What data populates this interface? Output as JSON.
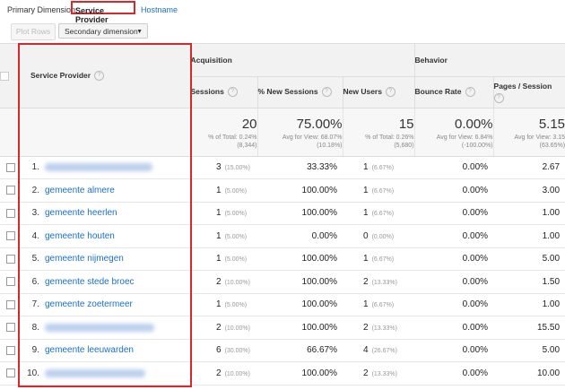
{
  "primary_dimension": {
    "label": "Primary Dimension:",
    "active": "Service Provider",
    "other": "Hostname"
  },
  "toolbar": {
    "plot_rows": "Plot Rows",
    "secondary_dimension": "Secondary dimension"
  },
  "groups": {
    "acquisition": "Acquisition",
    "behavior": "Behavior"
  },
  "columns": {
    "service_provider": "Service Provider",
    "sessions": "Sessions",
    "new_sessions": "% New Sessions",
    "new_users": "New Users",
    "bounce_rate": "Bounce Rate",
    "pages_session": "Pages / Session"
  },
  "totals": {
    "sessions": "20",
    "sessions_note1": "% of Total: 0.24%",
    "sessions_note2": "(8,344)",
    "new_sessions": "75.00%",
    "new_sessions_note1": "Avg for View: 68.07%",
    "new_sessions_note2": "(10.18%)",
    "new_users": "15",
    "new_users_note1": "% of Total: 0.26%",
    "new_users_note2": "(5,680)",
    "bounce_rate": "0.00%",
    "bounce_rate_note1": "Avg for View: 6.84%",
    "bounce_rate_note2": "(-100.00%)",
    "pages_session": "5.15",
    "pages_session_note1": "Avg for View: 3.15",
    "pages_session_note2": "(63.65%)"
  },
  "rows": [
    {
      "index": "1.",
      "provider": "",
      "sessions": "3",
      "sessions_pct": "(15.00%)",
      "new_sessions": "33.33%",
      "new_users": "1",
      "new_users_pct": "(6.67%)",
      "bounce": "0.00%",
      "pages": "2.67"
    },
    {
      "index": "2.",
      "provider": "gemeente almere",
      "sessions": "1",
      "sessions_pct": "(5.00%)",
      "new_sessions": "100.00%",
      "new_users": "1",
      "new_users_pct": "(6.67%)",
      "bounce": "0.00%",
      "pages": "3.00"
    },
    {
      "index": "3.",
      "provider": "gemeente heerlen",
      "sessions": "1",
      "sessions_pct": "(5.00%)",
      "new_sessions": "100.00%",
      "new_users": "1",
      "new_users_pct": "(6.67%)",
      "bounce": "0.00%",
      "pages": "1.00"
    },
    {
      "index": "4.",
      "provider": "gemeente houten",
      "sessions": "1",
      "sessions_pct": "(5.00%)",
      "new_sessions": "0.00%",
      "new_users": "0",
      "new_users_pct": "(0.00%)",
      "bounce": "0.00%",
      "pages": "1.00"
    },
    {
      "index": "5.",
      "provider": "gemeente nijmegen",
      "sessions": "1",
      "sessions_pct": "(5.00%)",
      "new_sessions": "100.00%",
      "new_users": "1",
      "new_users_pct": "(6.67%)",
      "bounce": "0.00%",
      "pages": "5.00"
    },
    {
      "index": "6.",
      "provider": "gemeente stede broec",
      "sessions": "2",
      "sessions_pct": "(10.00%)",
      "new_sessions": "100.00%",
      "new_users": "2",
      "new_users_pct": "(13.33%)",
      "bounce": "0.00%",
      "pages": "1.50"
    },
    {
      "index": "7.",
      "provider": "gemeente zoetermeer",
      "sessions": "1",
      "sessions_pct": "(5.00%)",
      "new_sessions": "100.00%",
      "new_users": "1",
      "new_users_pct": "(6.67%)",
      "bounce": "0.00%",
      "pages": "1.00"
    },
    {
      "index": "8.",
      "provider": "",
      "sessions": "2",
      "sessions_pct": "(10.00%)",
      "new_sessions": "100.00%",
      "new_users": "2",
      "new_users_pct": "(13.33%)",
      "bounce": "0.00%",
      "pages": "15.50"
    },
    {
      "index": "9.",
      "provider": "gemeente leeuwarden",
      "sessions": "6",
      "sessions_pct": "(30.00%)",
      "new_sessions": "66.67%",
      "new_users": "4",
      "new_users_pct": "(26.67%)",
      "bounce": "0.00%",
      "pages": "5.00"
    },
    {
      "index": "10.",
      "provider": "",
      "sessions": "2",
      "sessions_pct": "(10.00%)",
      "new_sessions": "100.00%",
      "new_users": "2",
      "new_users_pct": "(13.33%)",
      "bounce": "0.00%",
      "pages": "10.00"
    }
  ],
  "colors": {
    "highlight": "#d9272e",
    "link": "#1a6fc9"
  }
}
